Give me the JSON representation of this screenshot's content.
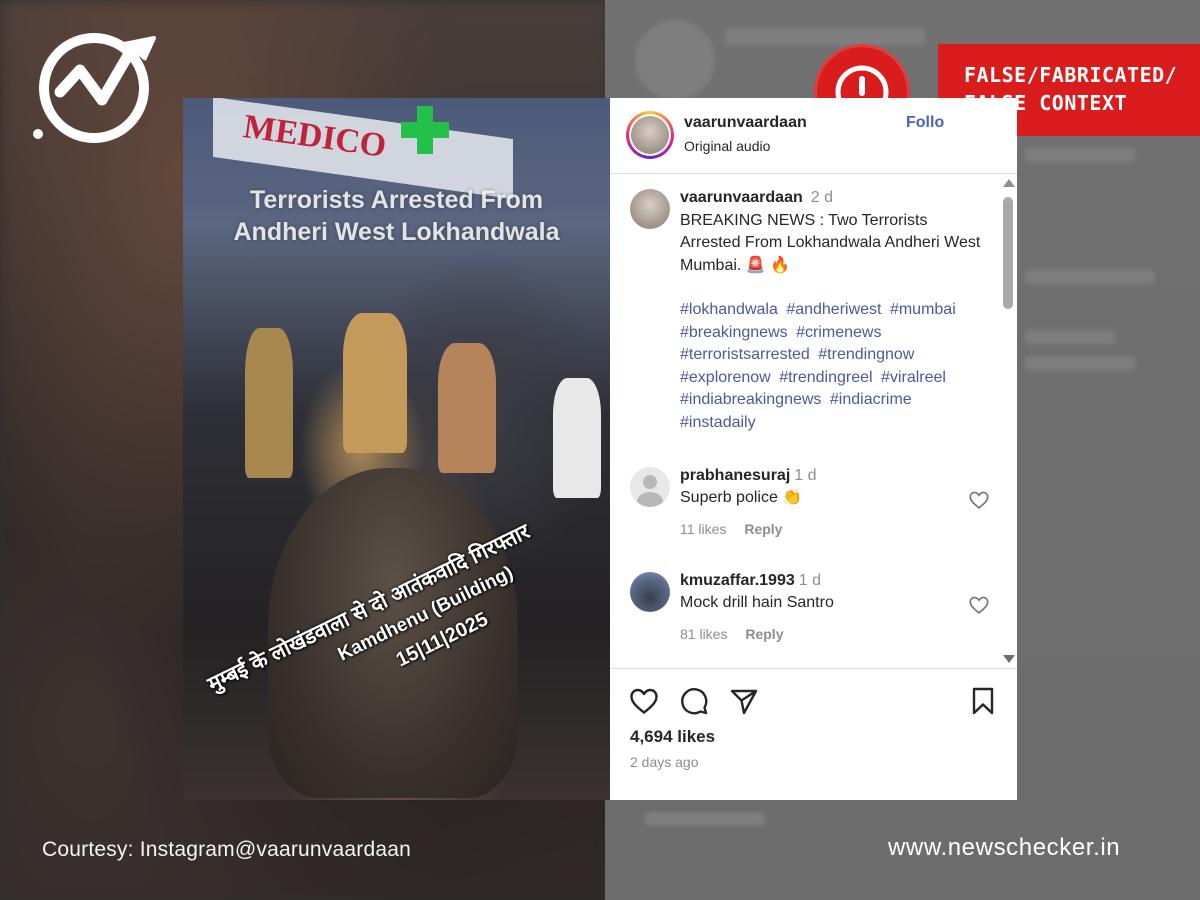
{
  "verdict": {
    "line1": "FALSE/FABRICATED/",
    "line2": "FALSE CONTEXT",
    "color": "#d91d1d"
  },
  "video": {
    "shop_sign": "MEDICO",
    "title_line1": "Terrorists Arrested From",
    "title_line2": "Andheri West Lokhandwala",
    "hindi_line1": "मुम्बई के लोखंडवाला से दो आतंकवादि गिरफ्तार",
    "hindi_line2": "Kamdhenu (Building)",
    "hindi_line3": "15|11|2025"
  },
  "instagram": {
    "header": {
      "username": "vaarunvaardaan",
      "audio": "Original audio",
      "follow_label": "Follo"
    },
    "caption": {
      "username": "vaarunvaardaan",
      "time": "2 d",
      "text": "BREAKING NEWS : Two Terrorists Arrested From Lokhandwala Andheri West Mumbai. 🚨 🔥",
      "hashtags": [
        "#lokhandwala",
        "#andheriwest",
        "#mumbai",
        "#breakingnews",
        "#crimenews",
        "#terroristsarrested",
        "#trendingnow",
        "#explorenow",
        "#trendingreel",
        "#viralreel",
        "#indiabreakingnews",
        "#indiacrime",
        "#instadaily"
      ]
    },
    "comments": [
      {
        "username": "prabhanesuraj",
        "time": "1 d",
        "text": "Superb police 👏",
        "likes": "11 likes",
        "reply": "Reply"
      },
      {
        "username": "kmuzaffar.1993",
        "time": "1 d",
        "text": "Mock drill hain Santro",
        "likes": "81 likes",
        "reply": "Reply"
      }
    ],
    "likes_count": "4,694 likes",
    "post_age": "2 days ago"
  },
  "footer": {
    "courtesy": "Courtesy: Instagram@vaarunvaardaan",
    "site": "www.newschecker.in"
  }
}
